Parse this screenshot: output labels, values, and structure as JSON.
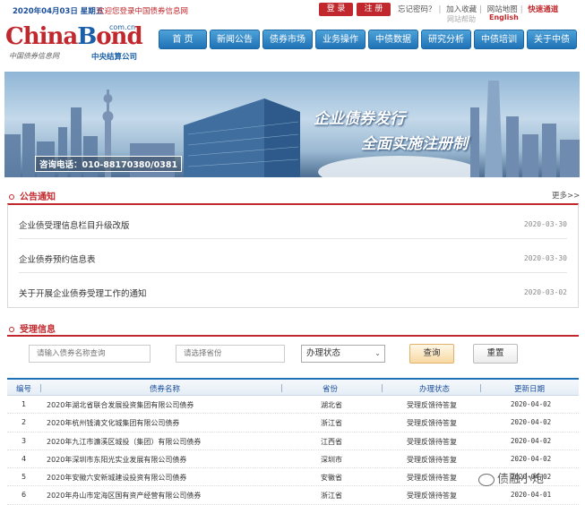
{
  "topbar": {
    "date": "2020年04月03日",
    "weekday": "星期五",
    "welcome": "欢迎您登录中国债券信息网",
    "login_label": "登 录",
    "register_label": "注 册",
    "forgot_password": "忘记密码？",
    "favorite": "加入收藏",
    "sitemap": "网站地图",
    "quick_access": "快速通道",
    "help": "网站帮助",
    "english": "English"
  },
  "logo": {
    "brand_red": "China",
    "brand_blue": "B",
    "brand_red2": "ond",
    "domain": "com.cn",
    "tagline": "中国债券信息网",
    "company": "中央结算公司"
  },
  "nav": {
    "items": [
      "首 页",
      "新闻公告",
      "债券市场",
      "业务操作",
      "中债数据",
      "研究分析",
      "中债培训",
      "关于中债"
    ]
  },
  "banner": {
    "line1": "企业债券发行",
    "line2": "全面实施注册制",
    "hotline": "咨询电话：010-88170380/0381"
  },
  "notices": {
    "section_title": "公告通知",
    "more": "更多>>",
    "items": [
      {
        "title": "企业债受理信息栏目升级改版",
        "date": "2020-03-30"
      },
      {
        "title": "企业债券预约信息表",
        "date": "2020-03-30"
      },
      {
        "title": "关于开展企业债券受理工作的通知",
        "date": "2020-03-02"
      }
    ]
  },
  "acceptance": {
    "section_title": "受理信息",
    "name_placeholder": "请输入债券名称查询",
    "province_placeholder": "请选择省份",
    "status_select": "办理状态",
    "query_label": "查询",
    "reset_label": "重置"
  },
  "table": {
    "headers": [
      "编号",
      "债券名称",
      "省份",
      "办理状态",
      "更新日期"
    ],
    "rows": [
      {
        "no": "1",
        "name": "2020年湖北省联合发展投资集团有限公司债券",
        "province": "湖北省",
        "status": "受理反馈待答复",
        "date": "2020-04-02"
      },
      {
        "no": "2",
        "name": "2020年杭州钱清文化城集团有限公司债券",
        "province": "浙江省",
        "status": "受理反馈待答复",
        "date": "2020-04-02"
      },
      {
        "no": "3",
        "name": "2020年九江市濂溪区城投（集团）有限公司债券",
        "province": "江西省",
        "status": "受理反馈待答复",
        "date": "2020-04-02"
      },
      {
        "no": "4",
        "name": "2020年深圳市东阳光实业发展有限公司债券",
        "province": "深圳市",
        "status": "受理反馈待答复",
        "date": "2020-04-02"
      },
      {
        "no": "5",
        "name": "2020年安徽六安新城建设投资有限公司债券",
        "province": "安徽省",
        "status": "受理反馈待答复",
        "date": "2020-04-02"
      },
      {
        "no": "6",
        "name": "2020年舟山市定海区国有资产经营有限公司债券",
        "province": "浙江省",
        "status": "受理反馈待答复",
        "date": "2020-04-01"
      }
    ]
  },
  "watermark": "债融小炮",
  "colors": {
    "accent_red": "#c0282d",
    "nav_blue": "#1f72b6",
    "brand_blue": "#1a5fa8"
  }
}
